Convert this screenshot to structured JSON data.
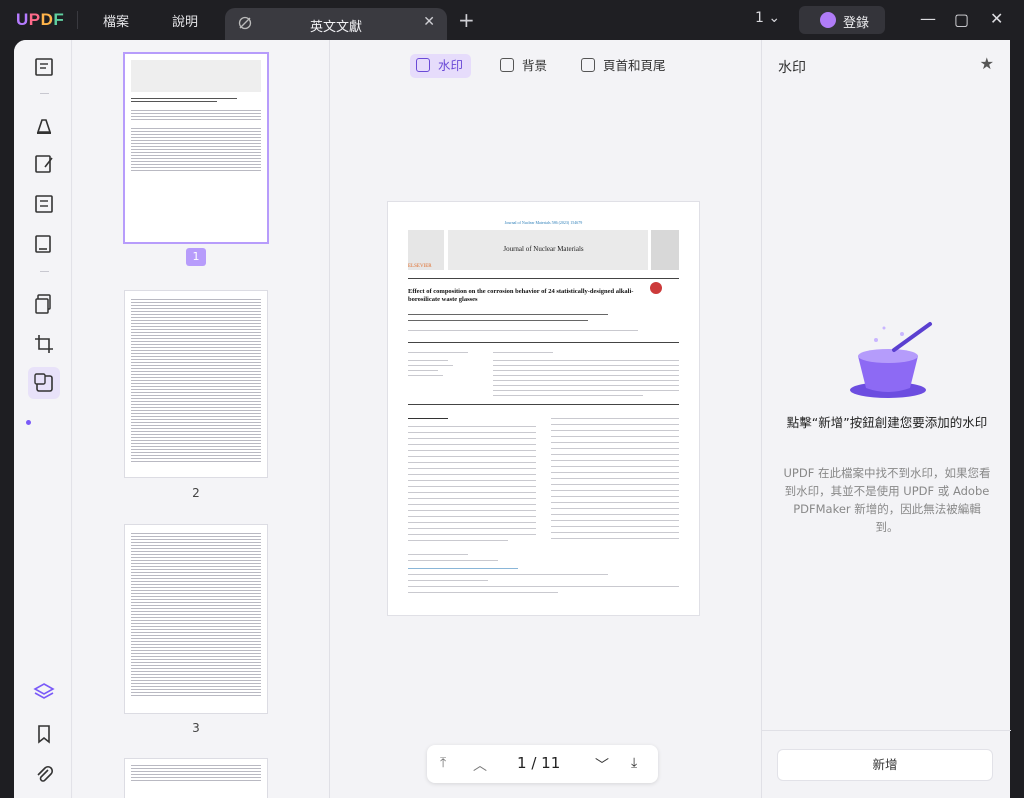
{
  "app": {
    "logo": "UPDF",
    "version_label": "1"
  },
  "menu": {
    "file": "檔案",
    "help": "說明"
  },
  "tab": {
    "title": "英文文獻"
  },
  "account": {
    "login_label": "登錄"
  },
  "toolbar_tabs": [
    {
      "label": "水印",
      "active": true
    },
    {
      "label": "背景",
      "active": false
    },
    {
      "label": "頁首和頁尾",
      "active": false
    }
  ],
  "thumbnails": [
    {
      "page": "1",
      "selected": true
    },
    {
      "page": "2",
      "selected": false
    },
    {
      "page": "3",
      "selected": false
    }
  ],
  "document": {
    "header_line": "Journal of Nuclear Materials 586 (2023) 154679",
    "journal_name": "Journal of Nuclear Materials",
    "publisher": "ELSEVIER",
    "title": "Effect of composition on the corrosion behavior of 24 statistically-designed alkali-borosilicate waste glasses"
  },
  "pager": {
    "current": "1",
    "separator": "/",
    "total": "11"
  },
  "right_panel": {
    "title": "水印",
    "prompt": "點擊“新增”按鈕創建您要添加的水印",
    "note": "UPDF 在此檔案中找不到水印，如果您看到水印，其並不是使用 UPDF 或 Adobe PDFMaker 新增的，因此無法被編輯到。",
    "add_button": "新增"
  },
  "colors": {
    "accent": "#7a5af8",
    "titlebar": "#1f1f23"
  }
}
